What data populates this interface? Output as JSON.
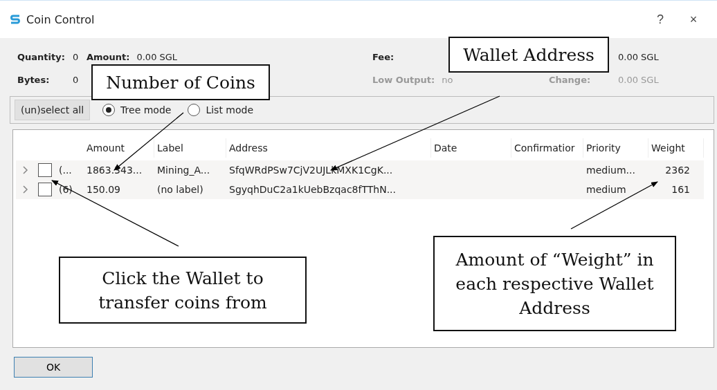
{
  "window": {
    "title": "Coin Control",
    "buttons": [
      "?",
      "×"
    ]
  },
  "summary": [
    {
      "kind": "pair",
      "label": "Quantity:",
      "value": "0",
      "dimmed": false
    },
    {
      "kind": "pair",
      "label": "Amount:",
      "value": "0.00 SGL",
      "dimmed": false
    },
    {
      "kind": "label",
      "label": "Fee:",
      "dimmed": false
    },
    {
      "kind": "value",
      "value": "0.00 SGL",
      "dimmed": false
    },
    {
      "kind": "pair",
      "label": "Bytes:",
      "value": "0",
      "dimmed": false
    },
    {
      "kind": "blank"
    },
    {
      "kind": "pair",
      "label": "Low Output:",
      "value": "no",
      "dimmed": true
    },
    {
      "kind": "pair",
      "label": "Change:",
      "value": "0.00 SGL",
      "dimmed": true
    }
  ],
  "toolbar": {
    "button": "(un)select all",
    "modes": [
      {
        "label": "Tree mode",
        "selected": true
      },
      {
        "label": "List mode",
        "selected": false
      }
    ]
  },
  "table": {
    "columns": [
      "Amount",
      "Label",
      "Address",
      "Date",
      "Confirmatior",
      "Priority",
      "Weight"
    ],
    "rows": [
      {
        "checked": false,
        "count": "(...",
        "amount": "1863.343...",
        "label": "Mining_A...",
        "address": "SfqWRdPSw7CjV2UJLkMXK1CgK...",
        "priority": "medium...",
        "weight": "2362"
      },
      {
        "checked": false,
        "count": "(6)",
        "amount": "150.09",
        "label": "(no label)",
        "address": "SgyqhDuC2a1kUebBzqac8fTThN...",
        "priority": "medium",
        "weight": "161"
      }
    ]
  },
  "ok_button": "OK",
  "callouts": [
    {
      "text": "Number of Coins"
    },
    {
      "text": "Wallet Address"
    },
    {
      "text": "Click the Wallet to transfer coins from"
    },
    {
      "text": "Amount of “Weight” in each respective Wallet Address"
    }
  ]
}
